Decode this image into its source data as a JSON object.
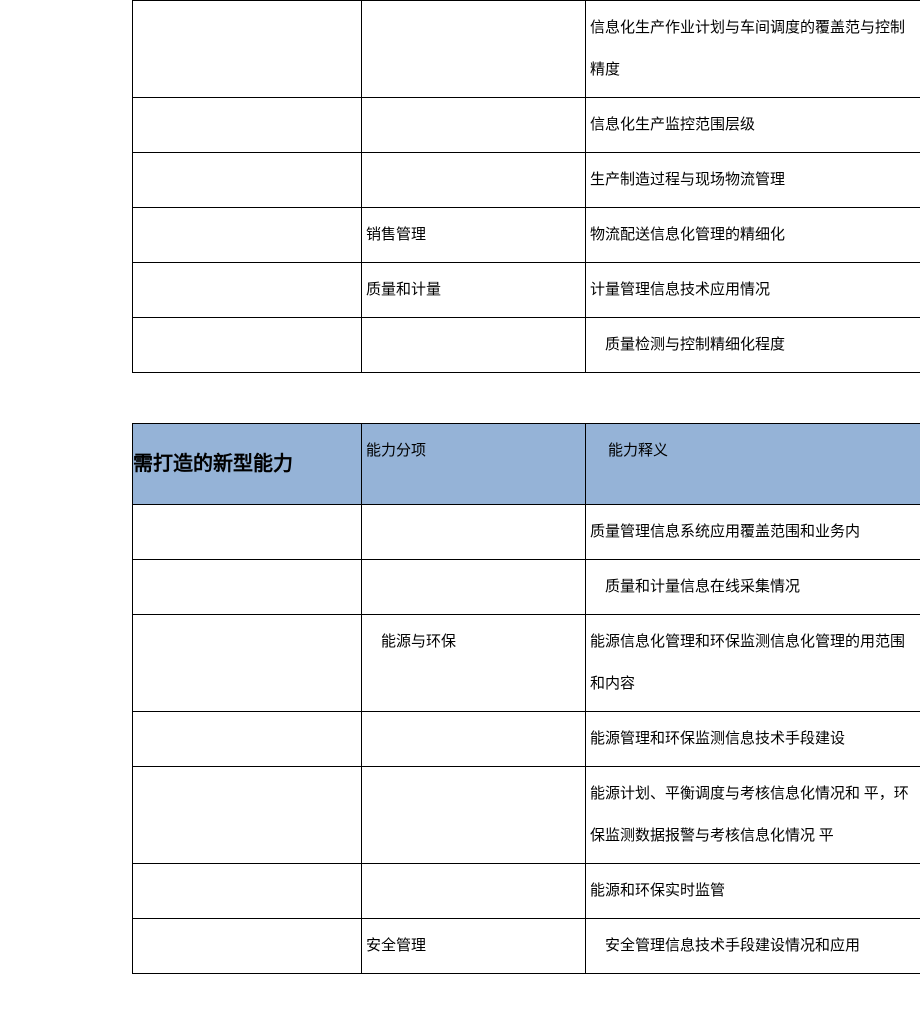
{
  "table1": {
    "rows": [
      {
        "c1": "",
        "c2": "",
        "c3": "信息化生产作业计划与车间调度的覆盖范与控制精度"
      },
      {
        "c1": "",
        "c2": "",
        "c3": "信息化生产监控范围层级"
      },
      {
        "c1": "",
        "c2": "",
        "c3": "生产制造过程与现场物流管理"
      },
      {
        "c1": "",
        "c2": "销售管理",
        "c3": "物流配送信息化管理的精细化"
      },
      {
        "c1": "",
        "c2": "质量和计量",
        "c3": "计量管理信息技术应用情况"
      },
      {
        "c1": "",
        "c2": "",
        "c3": "　质量检测与控制精细化程度"
      }
    ]
  },
  "table2": {
    "header": {
      "h1": "需打造的新型能力",
      "h2": "能力分项",
      "h3": "能力释义"
    },
    "rows": [
      {
        "c1": "",
        "c2": "",
        "c3": "质量管理信息系统应用覆盖范围和业务内"
      },
      {
        "c1": "",
        "c2": "",
        "c3": "　质量和计量信息在线采集情况"
      },
      {
        "c1": "",
        "c2": "　能源与环保",
        "c3": "能源信息化管理和环保监测信息化管理的用范围和内容"
      },
      {
        "c1": "",
        "c2": "",
        "c3": "能源管理和环保监测信息技术手段建设"
      },
      {
        "c1": "",
        "c2": "",
        "c3": "能源计划、平衡调度与考核信息化情况和  平，环保监测数据报警与考核信息化情况  平"
      },
      {
        "c1": "",
        "c2": "",
        "c3": "能源和环保实时监管"
      },
      {
        "c1": "",
        "c2": "安全管理",
        "c3": "　安全管理信息技术手段建设情况和应用"
      }
    ]
  }
}
